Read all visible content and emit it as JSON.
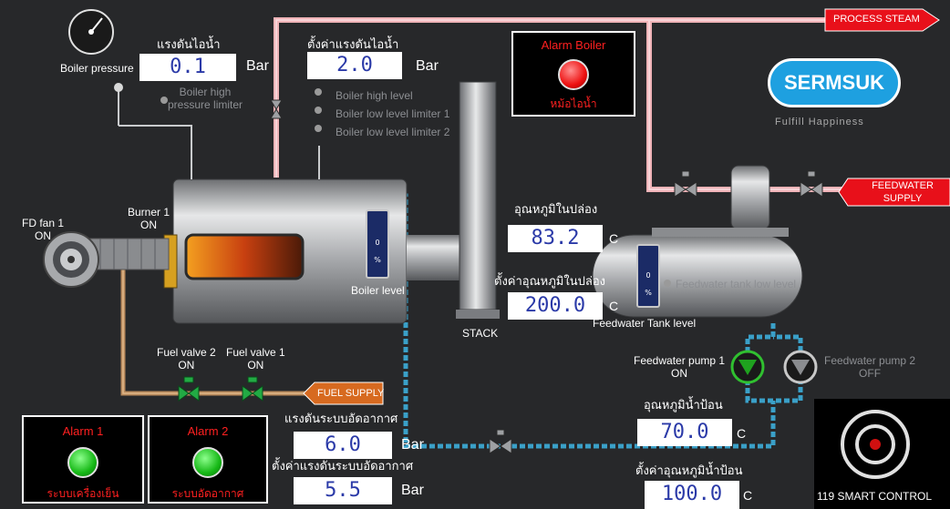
{
  "labels": {
    "boiler_pressure": "Boiler pressure",
    "boiler_pressure_title": "แรงดันไอน้ำ",
    "setpoint_pressure_title": "ตั้งค่าแรงดันไอน้ำ",
    "boiler_high_pressure_limiter": "Boiler high\npressure limiter",
    "boiler_high_level": "Boiler high level",
    "boiler_low_level_limiter_1": "Boiler low level limiter 1",
    "boiler_low_level_limiter_2": "Boiler low level limiter 2",
    "fd_fan": "FD fan 1\nON",
    "burner": "Burner 1\nON",
    "boiler_level": "Boiler level",
    "stack": "STACK",
    "flue_temp_title": "อุณหภูมิในปล่อง",
    "flue_temp_setpoint_title": "ตั้งค่าอุณหภูมิในปล่อง",
    "feedwater_tank_level": "Feedwater Tank level",
    "feedwater_tank_low_level": "Feedwater tank low level",
    "fuel_valve_2": "Fuel valve 2\nON",
    "fuel_valve_1": "Fuel valve 1\nON",
    "feedwater_pump_1": "Feedwater pump 1\nON",
    "feedwater_pump_2": "Feedwater pump 2\nOFF",
    "feedwater_temp_title": "อุณหภูมิน้ำป้อน",
    "feedwater_temp_setpoint_title": "ตั้งค่าอุณหภูมิน้ำป้อน",
    "air_pressure_title": "แรงดันระบบอัดอากาศ",
    "air_pressure_setpoint_title": "ตั้งค่าแรงดันระบบอัดอากาศ"
  },
  "values": {
    "boiler_pressure": "0.1",
    "boiler_pressure_setpoint": "2.0",
    "flue_temp": "83.2",
    "flue_temp_setpoint": "200.0",
    "feedwater_temp": "70.0",
    "feedwater_temp_setpoint": "100.0",
    "air_pressure": "6.0",
    "air_pressure_setpoint": "5.5",
    "boiler_level_value": "0",
    "feedwater_tank_level_value": "0",
    "level_unit": "%"
  },
  "units": {
    "bar": "Bar",
    "celsius": "C"
  },
  "arrows": {
    "process_steam": "PROCESS STEAM",
    "feedwater_supply": "FEEDWATER\nSUPPLY",
    "fuel_supply": "FUEL SUPPLY"
  },
  "alarms": {
    "boiler": {
      "title": "Alarm Boiler",
      "subtitle": "หม้อไอน้ำ",
      "state": "red"
    },
    "alarm1": {
      "title": "Alarm 1",
      "subtitle": "ระบบเครื่องเย็น",
      "state": "green"
    },
    "alarm2": {
      "title": "Alarm 2",
      "subtitle": "ระบบอัดอากาศ",
      "state": "green"
    }
  },
  "branding": {
    "sermsuk": "SERMSUK",
    "tagline": "Fulfill Happiness",
    "smart_control": "119 SMART CONTROL"
  },
  "colors": {
    "steam_pipe": "#f0b4b8",
    "water_pipe": "#3aa0c8",
    "fuel_pipe": "#b98a5c",
    "alarm_red": "#ff2020",
    "value_blue": "#2b3aa8"
  }
}
